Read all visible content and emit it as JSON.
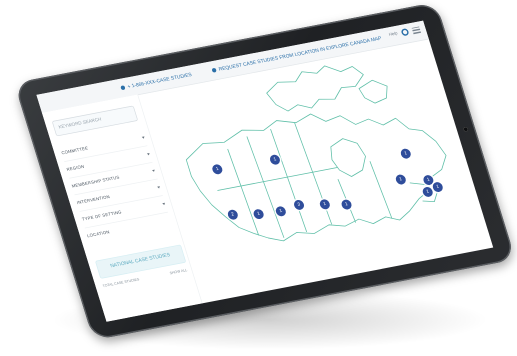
{
  "app": {
    "topbar": {
      "item1": "+ 1-866-XXX-CASE STUDIES",
      "item2": "REQUEST CASE STUDIES FROM LOCATION IN EXPLORE CANADA MAP",
      "tools_label": "Help"
    },
    "sidebar": {
      "search_placeholder": "KEYWORD SEARCH",
      "filters": [
        {
          "label": "COMMITTEE"
        },
        {
          "label": "REGION"
        },
        {
          "label": "MEMBERSHIP STATUS"
        },
        {
          "label": "INTERVENTION"
        },
        {
          "label": "TYPE OF SETTING"
        },
        {
          "label": "LOCATION"
        }
      ],
      "national_label": "NATIONAL CASE STUDIES",
      "bottom_left": "TOTAL CASE STUDIES",
      "bottom_right": "SHOW ALL"
    },
    "map": {
      "markers": [
        "1",
        "1",
        "1",
        "2",
        "1",
        "1",
        "3",
        "1",
        "1",
        "1",
        "1",
        "1",
        "1"
      ]
    },
    "colors": {
      "accent": "#2a6fa8",
      "marker": "#2f4d9b",
      "map_line": "#5fbfa8",
      "national_bg": "#e9f5f8"
    }
  }
}
